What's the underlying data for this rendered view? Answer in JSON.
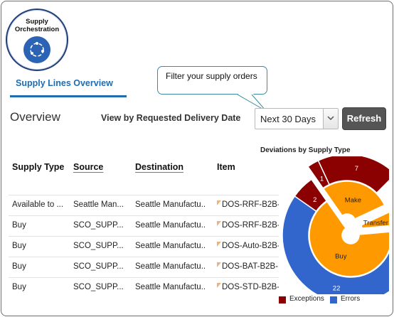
{
  "app_tile": {
    "line1": "Supply",
    "line2": "Orchestration",
    "icon": "supply-orchestration-icon"
  },
  "tab": {
    "label": "Supply Lines Overview"
  },
  "callout": {
    "text": "Filter your supply orders"
  },
  "overview": {
    "title": "Overview",
    "view_by_label": "View by Requested Delivery Date",
    "select_value": "Next 30 Days",
    "refresh_label": "Refresh"
  },
  "table": {
    "columns": [
      "Supply Type",
      "Source",
      "Destination",
      "Item"
    ],
    "rows": [
      [
        "Available to ...",
        "Seattle Man...",
        "Seattle Manufactu...",
        "DOS-RRF-B2B-"
      ],
      [
        "Buy",
        "SCO_SUPP...",
        "Seattle Manufactu...",
        "DOS-RRF-B2B-"
      ],
      [
        "Buy",
        "SCO_SUPP...",
        "Seattle Manufactu...",
        "DOS-Auto-B2B-"
      ],
      [
        "Buy",
        "SCO_SUPP...",
        "Seattle Manufactu...",
        "DOS-BAT-B2B-"
      ],
      [
        "Buy",
        "SCO_SUPP...",
        "Seattle Manufactu...",
        "DOS-STD-B2B-"
      ]
    ]
  },
  "colors": {
    "exceptions": "#8b0000",
    "errors": "#3366cc",
    "inner": "#ff9900",
    "accent": "#1f6cb1"
  },
  "chart_data": {
    "type": "pie",
    "title": "Deviations by Supply Type",
    "legend_position": "bottom",
    "legend": [
      "Exceptions",
      "Errors"
    ],
    "inner": {
      "categories": [
        "Make",
        "Transfer",
        "Buy"
      ],
      "values": [
        10,
        2,
        24
      ]
    },
    "outer": {
      "segments": [
        {
          "parent": "Make",
          "series": "Exceptions",
          "value": 1
        },
        {
          "parent": "Make",
          "series": "Exceptions",
          "value": 7
        },
        {
          "parent": "Transfer",
          "series": "Errors",
          "value": 2
        },
        {
          "parent": "Buy",
          "series": "Errors",
          "value": 22
        },
        {
          "parent": "Buy",
          "series": "Exceptions",
          "value": 2
        }
      ]
    }
  }
}
